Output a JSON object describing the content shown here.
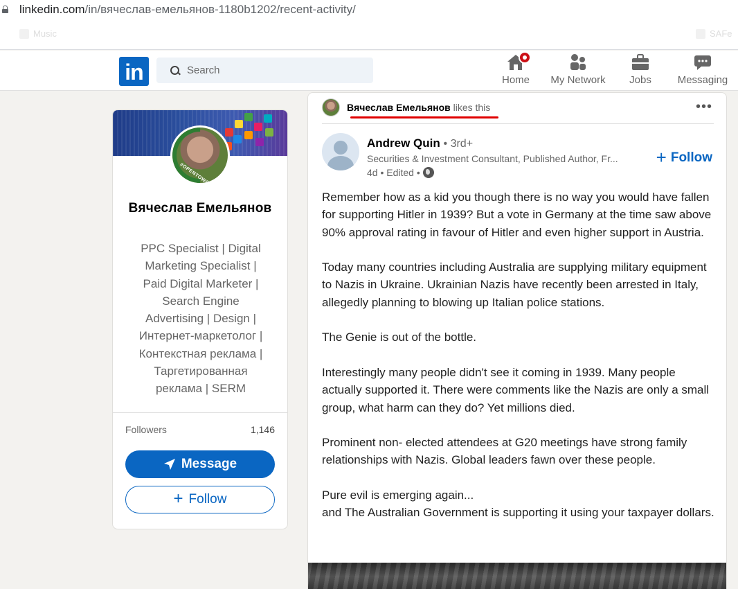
{
  "browser": {
    "url_host": "linkedin.com",
    "url_path": "/in/вячеслав-емельянов-1180b1202/recent-activity/",
    "bookmarks": [
      "Music",
      "",
      "",
      "",
      "",
      "",
      "",
      "SAFe"
    ]
  },
  "nav": {
    "search_placeholder": "Search",
    "items": [
      {
        "label": "Home",
        "icon": "home-icon"
      },
      {
        "label": "My Network",
        "icon": "network-icon"
      },
      {
        "label": "Jobs",
        "icon": "briefcase-icon"
      },
      {
        "label": "Messaging",
        "icon": "messaging-icon"
      }
    ]
  },
  "profile": {
    "name": "Вячеслав Емельянов",
    "badge": "#OPENTOWORK",
    "headline": "PPC Specialist | Digital Marketing Specialist | Paid Digital Marketer | Search Engine Advertising | Design | Интернет-маркетолог | Контекстная реклама | Таргетированная реклама | SERM",
    "followers_label": "Followers",
    "followers_count": "1,146",
    "message_label": "Message",
    "follow_label": "Follow"
  },
  "post": {
    "liker_name": "Вячеслав Емельянов",
    "liker_action": "likes this",
    "author_name": "Andrew Quin",
    "author_degree": "• 3rd+",
    "author_title": "Securities & Investment Consultant, Published Author, Fr...",
    "meta": "4d • Edited •",
    "follow_label": "Follow",
    "paragraphs": [
      "Remember how as a kid you though there is no way you would have fallen for supporting Hitler in 1939? But a vote in Germany at the time saw above 90% approval rating in favour of Hitler and even higher support in Austria.",
      "Today many countries including Australia are supplying military equipment to Nazis in Ukraine. Ukrainian Nazis have recently been arrested in Italy, allegedly planning to blowing up Italian police stations.",
      "The Genie is out of the bottle.",
      "Interestingly many people didn't see it coming in 1939. Many people actually supported it. There were comments like the Nazis are only a small group, what harm can they do? Yet millions died.",
      "Prominent non- elected attendees at G20 meetings have strong family relationships with Nazis. Global leaders fawn over these people.",
      "Pure evil is emerging again...\nand The Australian Government is supporting it using your taxpayer dollars."
    ]
  },
  "colors": {
    "brand": "#0a66c2",
    "badge_red": "#cc1016",
    "highlight": "#e00000"
  }
}
